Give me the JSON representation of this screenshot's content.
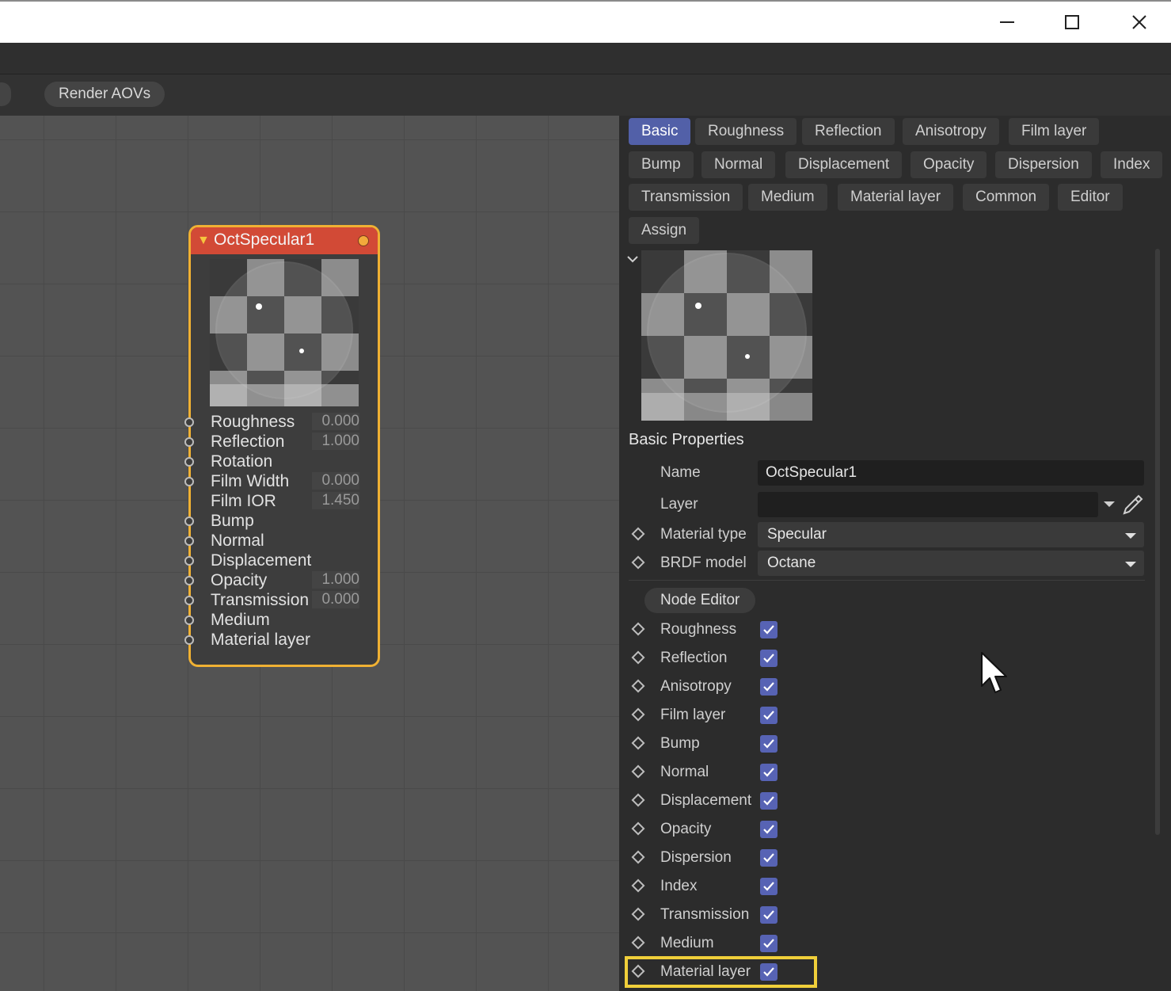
{
  "window": {
    "minimize_label": "minimize",
    "maximize_label": "maximize",
    "close_label": "close"
  },
  "toolbar": {
    "render_aovs": "Render AOVs"
  },
  "node": {
    "title": "OctSpecular1",
    "header_color": "#d24a36",
    "border_color": "#f0b133",
    "inputs": [
      {
        "label": "Roughness",
        "value": "0.000"
      },
      {
        "label": "Reflection",
        "value": "1.000"
      },
      {
        "label": "Rotation",
        "value": null
      },
      {
        "label": "Film Width",
        "value": "0.000"
      },
      {
        "label": "Film IOR",
        "value": "1.450"
      },
      {
        "label": "Bump",
        "value": null
      },
      {
        "label": "Normal",
        "value": null
      },
      {
        "label": "Displacement",
        "value": null
      },
      {
        "label": "Opacity",
        "value": "1.000"
      },
      {
        "label": "Transmission",
        "value": "0.000"
      },
      {
        "label": "Medium",
        "value": null
      },
      {
        "label": "Material layer",
        "value": null
      }
    ]
  },
  "panel": {
    "tabs": [
      {
        "label": "Basic",
        "active": true
      },
      {
        "label": "Roughness"
      },
      {
        "label": "Reflection"
      },
      {
        "label": "Anisotropy"
      },
      {
        "label": "Film layer"
      },
      {
        "label": "Bump"
      },
      {
        "label": "Normal"
      },
      {
        "label": "Displacement"
      },
      {
        "label": "Opacity"
      },
      {
        "label": "Dispersion"
      },
      {
        "label": "Index"
      },
      {
        "label": "Transmission"
      },
      {
        "label": "Medium"
      },
      {
        "label": "Material layer"
      },
      {
        "label": "Common"
      },
      {
        "label": "Editor"
      },
      {
        "label": "Assign"
      }
    ],
    "section_title": "Basic Properties",
    "name_label": "Name",
    "name_value": "OctSpecular1",
    "layer_label": "Layer",
    "layer_value": "",
    "material_type_label": "Material type",
    "material_type_value": "Specular",
    "brdf_label": "BRDF model",
    "brdf_value": "Octane",
    "node_editor_label": "Node Editor",
    "checkboxes": [
      {
        "label": "Roughness",
        "checked": true
      },
      {
        "label": "Reflection",
        "checked": true
      },
      {
        "label": "Anisotropy",
        "checked": true
      },
      {
        "label": "Film layer",
        "checked": true
      },
      {
        "label": "Bump",
        "checked": true
      },
      {
        "label": "Normal",
        "checked": true
      },
      {
        "label": "Displacement",
        "checked": true
      },
      {
        "label": "Opacity",
        "checked": true
      },
      {
        "label": "Dispersion",
        "checked": true
      },
      {
        "label": "Index",
        "checked": true
      },
      {
        "label": "Transmission",
        "checked": true
      },
      {
        "label": "Medium",
        "checked": true
      },
      {
        "label": "Material layer",
        "checked": true
      }
    ],
    "accent_color": "#5260a8",
    "highlight_color": "#f0cf3a"
  }
}
